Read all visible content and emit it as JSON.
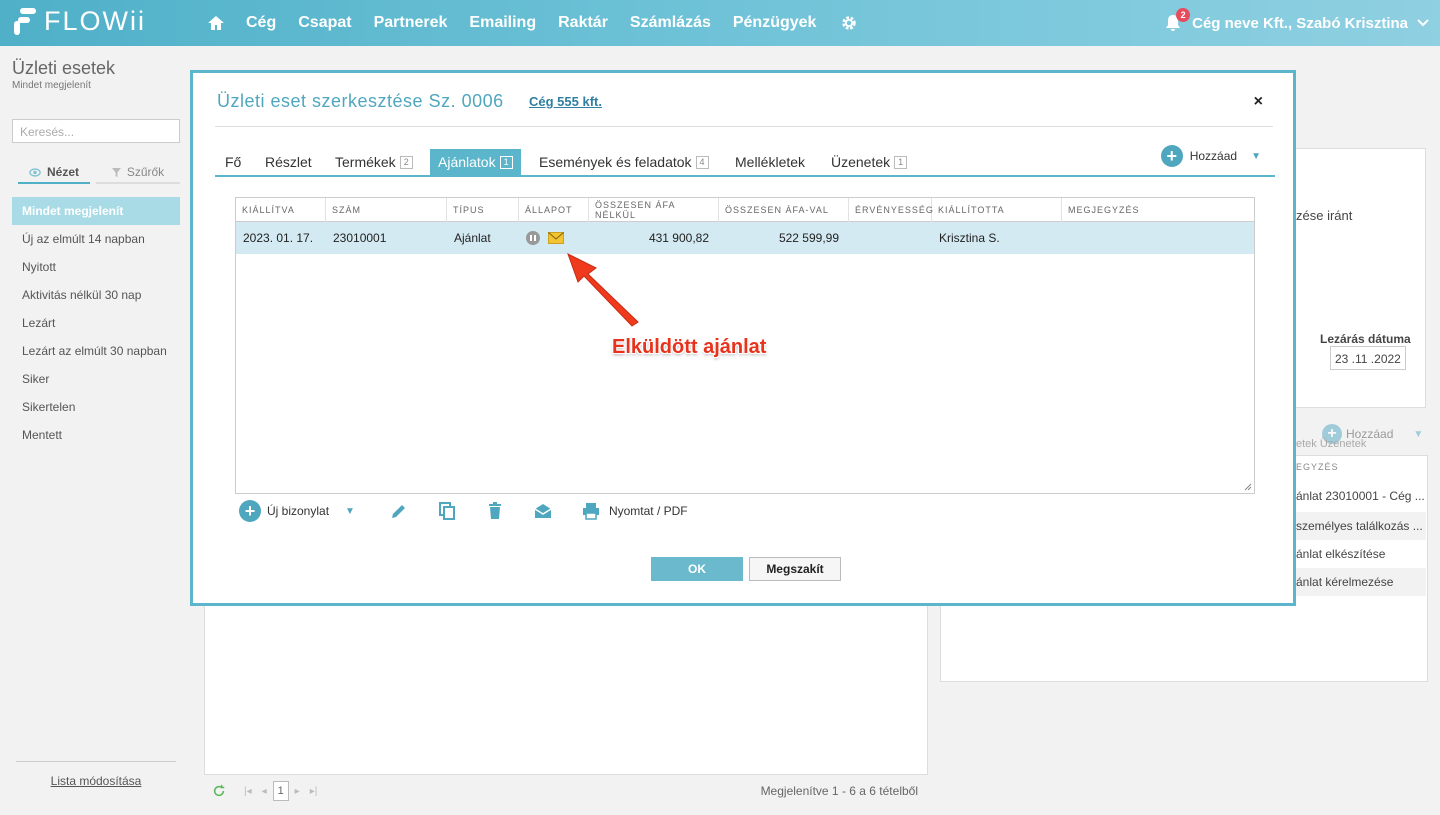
{
  "app": {
    "logo_text": "FLOWii"
  },
  "nav": {
    "items": [
      "Cég",
      "Csapat",
      "Partnerek",
      "Emailing",
      "Raktár",
      "Számlázás",
      "Pénzügyek"
    ],
    "notification_count": "2",
    "company_user": "Cég neve Kft., Szabó Krisztina"
  },
  "sidebar": {
    "title": "Üzleti esetek",
    "subtitle": "Mindet megjelenít",
    "search_placeholder": "Keresés...",
    "tab_view": "Nézet",
    "tab_filters": "Szűrők",
    "items": [
      "Mindet megjelenít",
      "Új az elmúlt 14 napban",
      "Nyitott",
      "Aktivitás nélkül 30 nap",
      "Lezárt",
      "Lezárt az elmúlt 30 napban",
      "Siker",
      "Sikertelen",
      "Mentett"
    ],
    "footer_link": "Lista módosítása"
  },
  "background": {
    "right_text_1": "zése iránt",
    "closing_date_label": "Lezárás dátuma",
    "closing_date_value": "23 .11 .2022",
    "add_label": "Hozzáad",
    "tabs_partial": "etek  Üzenetek",
    "col_partial": "EGYZÉS",
    "rows": [
      "ánlat 23010001 - Cég ...",
      "személyes találkozás ...",
      "ánlat elkészítése",
      "ánlat kérelmezése"
    ],
    "pager_page": "1",
    "pager_info": "Megjelenítve 1 - 6 a 6 tételből"
  },
  "modal": {
    "title": "Üzleti eset szerkesztése Sz. 0006",
    "company_link": "Cég 555 kft.",
    "close": "×",
    "tabs": [
      {
        "label": "Fő",
        "count": ""
      },
      {
        "label": "Részlet",
        "count": ""
      },
      {
        "label": "Termékek",
        "count": "2"
      },
      {
        "label": "Ajánlatok",
        "count": "1"
      },
      {
        "label": "Események és feladatok",
        "count": "4"
      },
      {
        "label": "Mellékletek",
        "count": ""
      },
      {
        "label": "Üzenetek",
        "count": "1"
      }
    ],
    "add_label": "Hozzáad",
    "grid": {
      "columns": [
        "KIÁLLÍTVA",
        "SZÁM",
        "TÍPUS",
        "ÁLLAPOT",
        "ÖSSZESEN ÁFA NÉLKÜL",
        "ÖSSZESEN ÁFA-VAL",
        "ÉRVÉNYESSÉG",
        "KIÁLLÍTOTTA",
        "MEGJEGYZÉS"
      ],
      "rows": [
        {
          "issued": "2023. 01. 17.",
          "number": "23010001",
          "type": "Ajánlat",
          "net_total": "431 900,82",
          "gross_total": "522 599,99",
          "validity": "",
          "issuer": "Krisztina S.",
          "note": ""
        }
      ]
    },
    "toolbar": {
      "new_document": "Új bizonylat",
      "print_pdf": "Nyomtat / PDF"
    },
    "ok": "OK",
    "cancel": "Megszakít"
  },
  "annotation": {
    "text": "Elküldött ajánlat",
    "color": "#e8321c"
  },
  "colors": {
    "accent": "#5bb5cb",
    "nav_gradient_start": "#4fb0c8",
    "selected_row": "#d4eaf2"
  }
}
